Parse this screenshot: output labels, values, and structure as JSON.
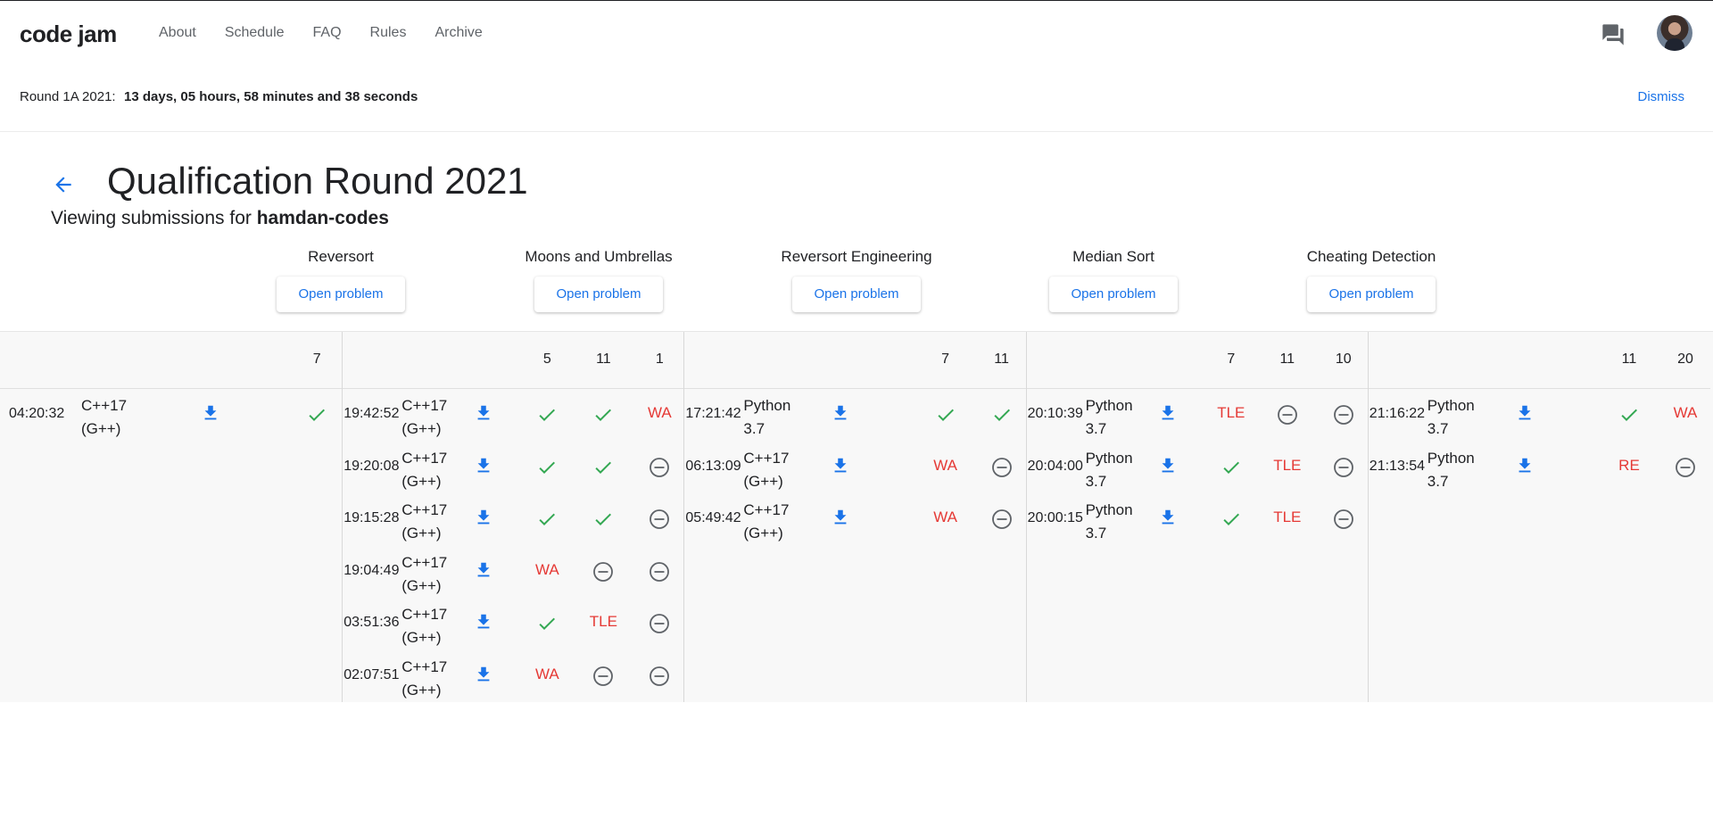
{
  "nav": {
    "logo": "code jam",
    "links": [
      "About",
      "Schedule",
      "FAQ",
      "Rules",
      "Archive"
    ],
    "icons": {
      "chat": "chat-icon",
      "avatar": "user-avatar"
    }
  },
  "banner": {
    "label": "Round 1A 2021:",
    "countdown": "13 days, 05 hours, 58 minutes and 38 seconds",
    "dismiss": "Dismiss"
  },
  "header": {
    "title": "Qualification Round 2021",
    "viewing_prefix": "Viewing submissions for ",
    "username": "hamdan-codes"
  },
  "colors": {
    "accent": "#1a73e8",
    "ok": "#34a853",
    "error": "#e53935",
    "skip": "#5f6368"
  },
  "problems": [
    {
      "name": "Reversort",
      "button": "Open problem",
      "scores": [
        "7"
      ],
      "submissions": [
        {
          "time": "04:20:32",
          "lang": [
            "C++17",
            "(G++)"
          ],
          "results": [
            "ok"
          ]
        }
      ]
    },
    {
      "name": "Moons and Umbrellas",
      "button": "Open problem",
      "scores": [
        "5",
        "11",
        "1"
      ],
      "submissions": [
        {
          "time": "19:42:52",
          "lang": [
            "C++17",
            "(G++)"
          ],
          "results": [
            "ok",
            "ok",
            "WA"
          ]
        },
        {
          "time": "19:20:08",
          "lang": [
            "C++17",
            "(G++)"
          ],
          "results": [
            "ok",
            "ok",
            "skip"
          ]
        },
        {
          "time": "19:15:28",
          "lang": [
            "C++17",
            "(G++)"
          ],
          "results": [
            "ok",
            "ok",
            "skip"
          ]
        },
        {
          "time": "19:04:49",
          "lang": [
            "C++17",
            "(G++)"
          ],
          "results": [
            "WA",
            "skip",
            "skip"
          ]
        },
        {
          "time": "03:51:36",
          "lang": [
            "C++17",
            "(G++)"
          ],
          "results": [
            "ok",
            "TLE",
            "skip"
          ]
        },
        {
          "time": "02:07:51",
          "lang": [
            "C++17",
            "(G++)"
          ],
          "results": [
            "WA",
            "skip",
            "skip"
          ]
        }
      ]
    },
    {
      "name": "Reversort Engineering",
      "button": "Open problem",
      "scores": [
        "7",
        "11"
      ],
      "submissions": [
        {
          "time": "17:21:42",
          "lang": [
            "Python",
            "3.7"
          ],
          "results": [
            "ok",
            "ok"
          ]
        },
        {
          "time": "06:13:09",
          "lang": [
            "C++17",
            "(G++)"
          ],
          "results": [
            "WA",
            "skip"
          ]
        },
        {
          "time": "05:49:42",
          "lang": [
            "C++17",
            "(G++)"
          ],
          "results": [
            "WA",
            "skip"
          ]
        }
      ]
    },
    {
      "name": "Median Sort",
      "button": "Open problem",
      "scores": [
        "7",
        "11",
        "10"
      ],
      "submissions": [
        {
          "time": "20:10:39",
          "lang": [
            "Python",
            "3.7"
          ],
          "results": [
            "TLE",
            "skip",
            "skip"
          ]
        },
        {
          "time": "20:04:00",
          "lang": [
            "Python",
            "3.7"
          ],
          "results": [
            "ok",
            "TLE",
            "skip"
          ]
        },
        {
          "time": "20:00:15",
          "lang": [
            "Python",
            "3.7"
          ],
          "results": [
            "ok",
            "TLE",
            "skip"
          ]
        }
      ]
    },
    {
      "name": "Cheating Detection",
      "button": "Open problem",
      "scores": [
        "11",
        "20"
      ],
      "submissions": [
        {
          "time": "21:16:22",
          "lang": [
            "Python",
            "3.7"
          ],
          "results": [
            "ok",
            "WA"
          ]
        },
        {
          "time": "21:13:54",
          "lang": [
            "Python",
            "3.7"
          ],
          "results": [
            "RE",
            "skip"
          ]
        }
      ]
    }
  ]
}
